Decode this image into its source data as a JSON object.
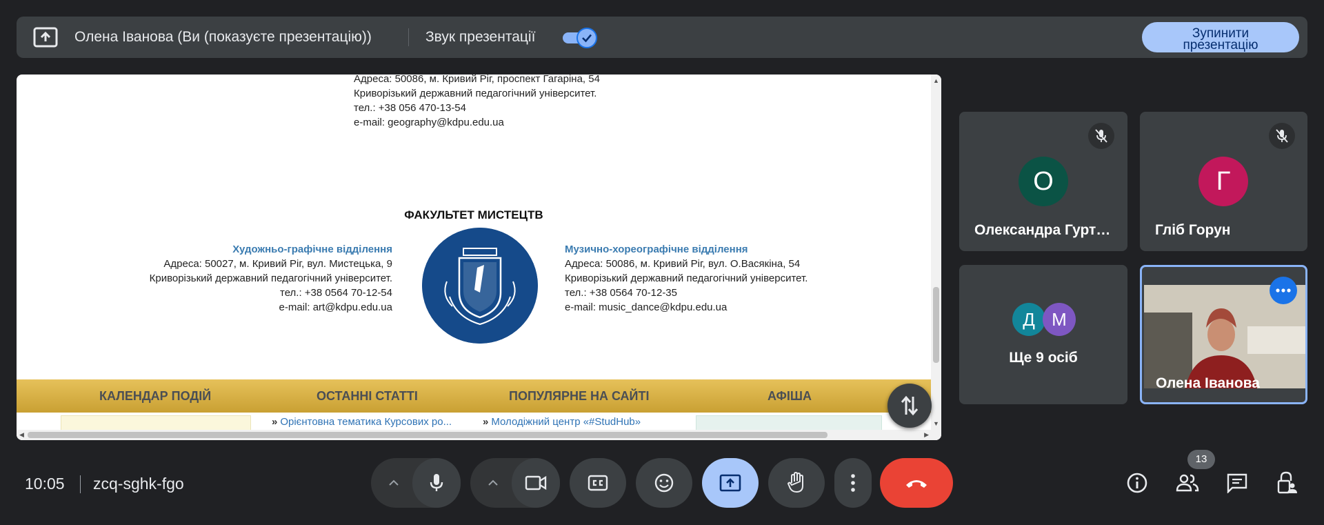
{
  "topbar": {
    "presenter_text": "Олена Іванова (Ви (показуєте презентацію))",
    "sound_label": "Звук презентації",
    "sound_enabled": true,
    "stop_button_line1": "Зупинити",
    "stop_button_line2": "презентацію"
  },
  "slide": {
    "top_address_lines": [
      "Адреса: 50086, м. Кривий Ріг, проспект Гагаріна, 54",
      "Криворізький державний педагогічний університет.",
      "тел.: +38 056 470-13-54",
      "e-mail: geography@kdpu.edu.ua"
    ],
    "faculty_title": "ФАКУЛЬТЕТ МИСТЕЦТВ",
    "left_dept": {
      "name": "Художньо-графічне відділення",
      "lines": [
        "Адреса: 50027, м. Кривий Ріг, вул. Мистецька, 9",
        "Криворізький державний педагогічний університет.",
        "тел.: +38 0564 70-12-54",
        "e-mail: art@kdpu.edu.ua"
      ]
    },
    "right_dept": {
      "name": "Музично-хореографічне відділення",
      "lines": [
        "Адреса: 50086, м. Кривий Ріг, вул. О.Васякіна, 54",
        "Криворізький державний педагогічний університет.",
        "тел.: +38 0564 70-12-35",
        "e-mail: music_dance@kdpu.edu.ua"
      ]
    },
    "footer_nav": [
      "КАЛЕНДАР ПОДІЙ",
      "ОСТАННІ СТАТТІ",
      "ПОПУЛЯРНЕ НА САЙТІ",
      "АФІША"
    ],
    "links": [
      "Орієнтовна тематика Курсових ро...",
      "Молодіжний центр «#StudHub»"
    ]
  },
  "participants": [
    {
      "initial": "О",
      "name": "Олександра Гуртова",
      "display_name": "Олександра Гурт…",
      "color": "#0b5345",
      "muted": true
    },
    {
      "initial": "Г",
      "name": "Гліб Горун",
      "display_name": "Гліб Горун",
      "color": "#c2185b",
      "muted": true
    }
  ],
  "more_tile": {
    "avatars": [
      {
        "initial": "Д",
        "color": "#12869a"
      },
      {
        "initial": "М",
        "color": "#7e57c2"
      }
    ],
    "label": "Ще 9 осіб"
  },
  "self_tile": {
    "name": "Олена Іванова"
  },
  "bottom": {
    "time": "10:05",
    "meeting_code": "zcq-sghk-fgo",
    "participant_count": "13"
  },
  "colors": {
    "accent": "#8ab4f8",
    "end_call": "#ea4335",
    "present_active": "#a8c7fa"
  }
}
